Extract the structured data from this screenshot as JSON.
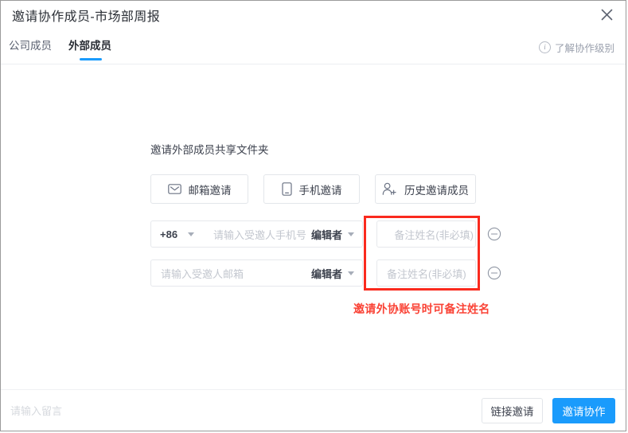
{
  "header": {
    "title": "邀请协作成员-市场部周报",
    "close_icon": "close-icon"
  },
  "tabs": {
    "items": [
      {
        "label": "公司成员",
        "active": false
      },
      {
        "label": "外部成员",
        "active": true
      }
    ],
    "learn_link": "了解协作级别",
    "info_icon": "i"
  },
  "main": {
    "section_title": "邀请外部成员共享文件夹",
    "method_buttons": [
      {
        "label": "邮箱邀请",
        "icon": "envelope-icon"
      },
      {
        "label": "手机邀请",
        "icon": "mobile-phone-icon"
      },
      {
        "label": "历史邀请成员",
        "icon": "person-add-icon"
      }
    ],
    "rows": [
      {
        "country_code": "+86",
        "input_placeholder": "请输入受邀人手机号",
        "role": "编辑者",
        "note_placeholder": "备注姓名(非必填)",
        "remove_icon": "circle-minus-icon"
      },
      {
        "input_placeholder": "请输入受邀人邮箱",
        "role": "编辑者",
        "note_placeholder": "备注姓名(非必填)",
        "remove_icon": "circle-minus-icon"
      }
    ],
    "annotation": "邀请外协账号时可备注姓名"
  },
  "footer": {
    "message_placeholder": "请输入留言",
    "link_invite_label": "链接邀请",
    "invite_label": "邀请协作"
  },
  "colors": {
    "accent_blue": "#1a9bfc",
    "annotation_red": "#fa4336",
    "highlight_red": "#fa2a1e",
    "text_primary": "#2b2f36",
    "placeholder": "#c3c7cf"
  }
}
